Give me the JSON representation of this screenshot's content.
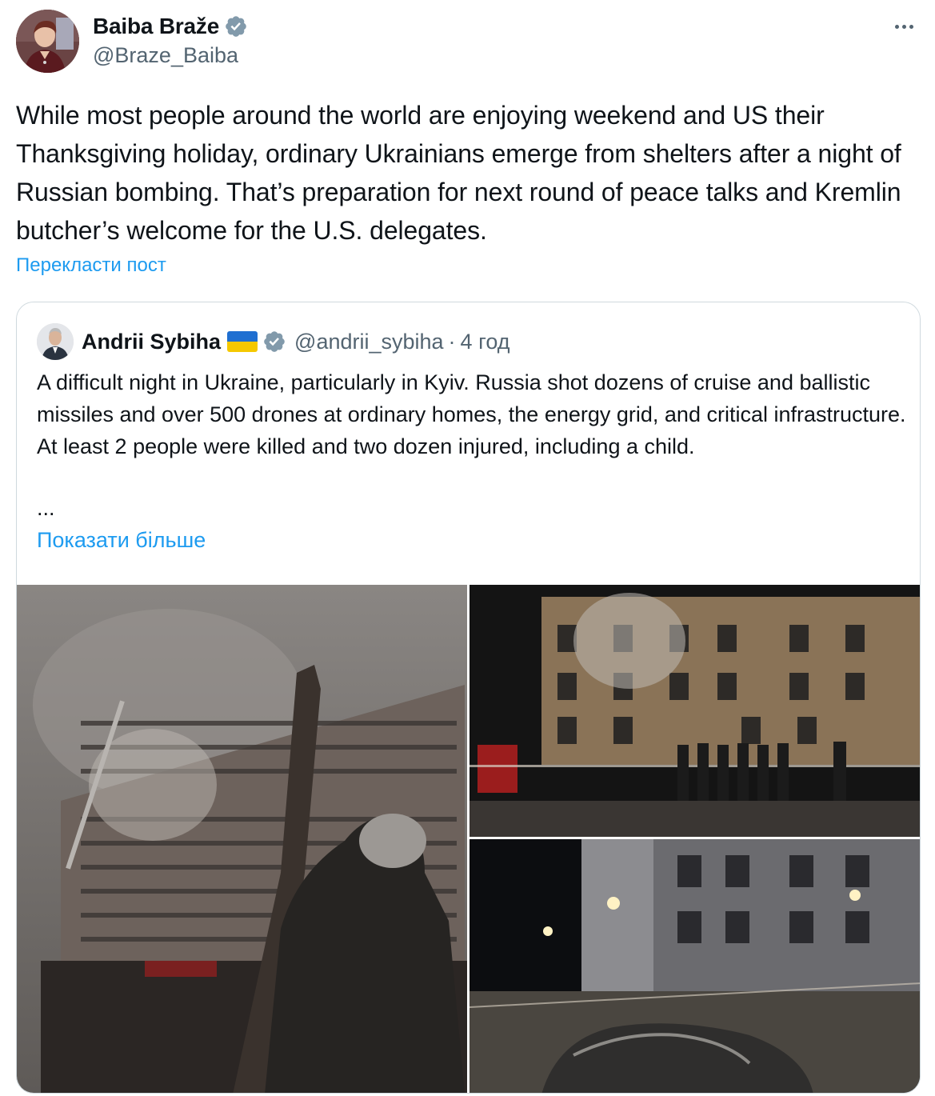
{
  "author": {
    "display_name": "Baiba Braže",
    "handle": "@Braze_Baiba",
    "verified": true,
    "avatar_icon": "profile-photo"
  },
  "post": {
    "text": "While most people around the world are enjoying weekend and US their Thanksgiving holiday, ordinary Ukrainians emerge from shelters after a night of Russian bombing. That’s preparation for next round of peace talks and Kremlin butcher’s welcome for the U.S. delegates.",
    "translate_label": "Перекласти пост",
    "more_icon": "more-dots-icon"
  },
  "quoted": {
    "display_name": "Andrii Sybiha",
    "flag_icon": "ukraine-flag-icon",
    "verified": true,
    "handle": "@andrii_sybiha",
    "separator": "·",
    "time": "4 год",
    "text": "A difficult night in Ukraine, particularly in Kyiv. Russia shot dozens of cruise and ballistic missiles and over 500 drones at ordinary homes, the energy grid, and critical infrastructure. At least 2 people were killed and two dozen injured, including a child.",
    "ellipsis": "...",
    "show_more_label": "Показати більше",
    "media": [
      {
        "icon": "photo-burning-apartment-block"
      },
      {
        "icon": "photo-damaged-building-night"
      },
      {
        "icon": "photo-destroyed-car-night"
      }
    ]
  },
  "colors": {
    "accent": "#1d9bf0",
    "text": "#0f1419",
    "secondary": "#536471",
    "border": "#cfd9de",
    "verified_badge": "#829aab"
  }
}
